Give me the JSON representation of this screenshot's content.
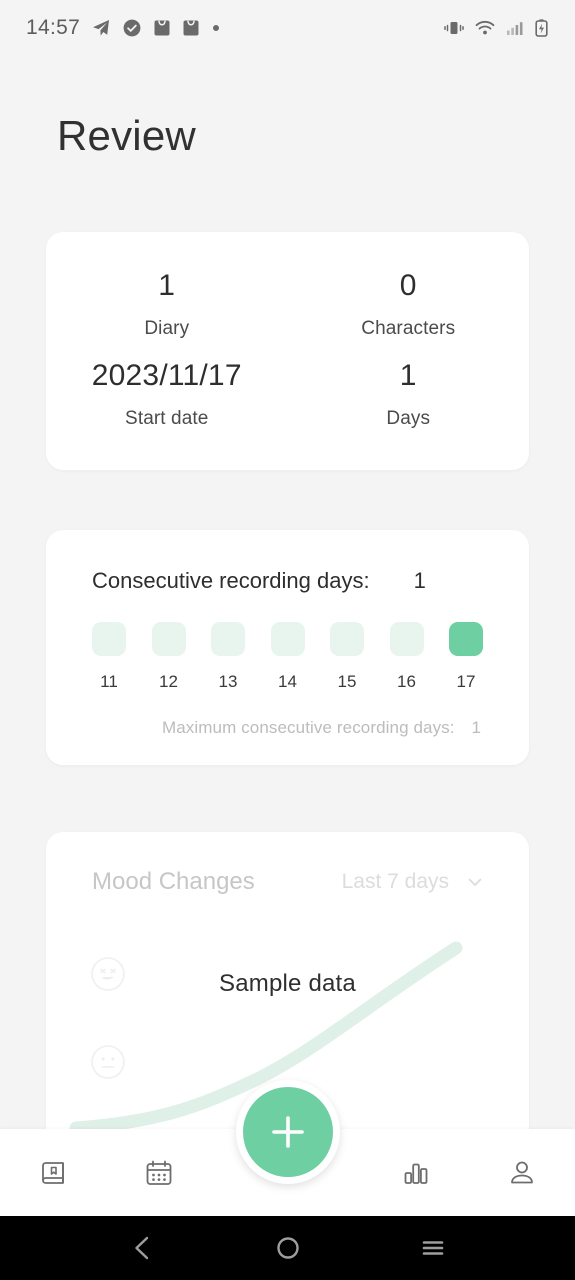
{
  "status_bar": {
    "time": "14:57",
    "left_icons": [
      "telegram-send-icon",
      "check-circle-icon",
      "mail-bag-icon",
      "mail-bag-icon",
      "dot-icon"
    ],
    "right_icons": [
      "vibrate-icon",
      "wifi-icon",
      "signal-icon",
      "battery-charging-icon"
    ]
  },
  "header": {
    "title": "Review"
  },
  "stats": {
    "items": [
      {
        "value": "1",
        "label": "Diary"
      },
      {
        "value": "0",
        "label": "Characters"
      },
      {
        "value": "2023/11/17",
        "label": "Start date"
      },
      {
        "value": "1",
        "label": "Days"
      }
    ]
  },
  "streak": {
    "title": "Consecutive recording days:",
    "count": "1",
    "days": [
      {
        "num": "11",
        "active": false
      },
      {
        "num": "12",
        "active": false
      },
      {
        "num": "13",
        "active": false
      },
      {
        "num": "14",
        "active": false
      },
      {
        "num": "15",
        "active": false
      },
      {
        "num": "16",
        "active": false
      },
      {
        "num": "17",
        "active": true
      }
    ],
    "max_label": "Maximum consecutive recording days:",
    "max_value": "1"
  },
  "mood": {
    "title": "Mood Changes",
    "range_label": "Last 7 days",
    "range_caret": "chevron-down-icon",
    "placeholder": "Sample data",
    "axis_faces": [
      "happy-face-icon",
      "neutral-face-icon"
    ]
  },
  "chart_data": {
    "type": "line",
    "title": "Mood Changes",
    "subtitle": "Sample data",
    "xlabel": "",
    "ylabel": "",
    "x": [
      1,
      2,
      3,
      4,
      5,
      6,
      7
    ],
    "values": [
      0.05,
      0.08,
      0.14,
      0.3,
      0.55,
      0.78,
      0.95
    ],
    "ytick_labels": [
      "happy-face-icon",
      "neutral-face-icon"
    ],
    "legend": [],
    "grid": false,
    "range": "Last 7 days",
    "line_color": "#d8efe3",
    "is_placeholder": true
  },
  "bottom_nav": {
    "items": [
      {
        "icon": "book-bookmark-icon",
        "name": "diary"
      },
      {
        "icon": "calendar-icon",
        "name": "calendar"
      },
      {
        "icon": "bar-chart-icon",
        "name": "review"
      },
      {
        "icon": "person-icon",
        "name": "profile"
      }
    ],
    "fab_icon": "plus-icon"
  },
  "android_nav": {
    "keys": [
      "back-icon",
      "home-icon",
      "recents-icon"
    ]
  },
  "colors": {
    "accent": "#6ecfa3",
    "accent_pale": "#e7f5ee",
    "page_bg": "#f4f4f4",
    "card_bg": "#ffffff",
    "text_primary": "#2e2e2e",
    "text_muted": "#bcbcbc"
  }
}
